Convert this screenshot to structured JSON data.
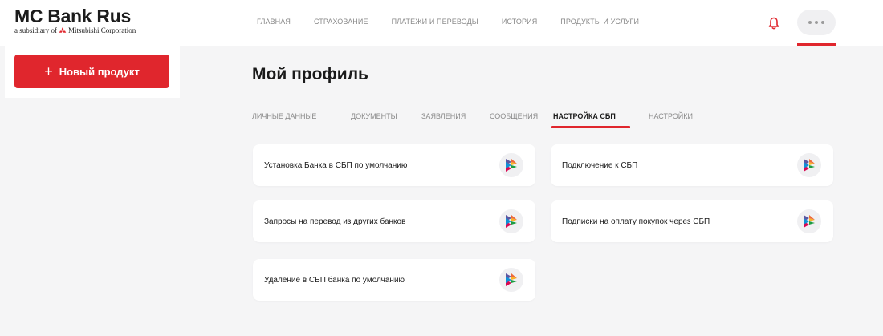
{
  "brand": {
    "title": "MC Bank Rus",
    "subtitle_prefix": "a subsidiary of",
    "subtitle_company": "Mitsubishi Corporation"
  },
  "nav": {
    "items": [
      {
        "label": "ГЛАВНАЯ"
      },
      {
        "label": "СТРАХОВАНИЕ"
      },
      {
        "label": "ПЛАТЕЖИ И ПЕРЕВОДЫ"
      },
      {
        "label": "ИСТОРИЯ"
      },
      {
        "label": "ПРОДУКТЫ И УСЛУГИ"
      }
    ],
    "bell_icon": "bell-icon",
    "more_icon": "more-dots-icon"
  },
  "sidebar": {
    "new_product_label": "Новый продукт",
    "new_product_icon": "plus-icon"
  },
  "main": {
    "title": "Мой профиль",
    "tabs": [
      {
        "label": "ЛИЧНЫЕ ДАННЫЕ",
        "active": false
      },
      {
        "label": "ДОКУМЕНТЫ",
        "active": false
      },
      {
        "label": "ЗАЯВЛЕНИЯ",
        "active": false
      },
      {
        "label": "СООБЩЕНИЯ",
        "active": false
      },
      {
        "label": "НАСТРОЙКА СБП",
        "active": true
      },
      {
        "label": "НАСТРОЙКИ",
        "active": false
      }
    ],
    "cards": [
      {
        "label": "Установка Банка в СБП по умолчанию",
        "icon": "sbp-icon"
      },
      {
        "label": "Подключение к СБП",
        "icon": "sbp-icon"
      },
      {
        "label": "Запросы на перевод из других банков",
        "icon": "sbp-icon"
      },
      {
        "label": "Подписки на оплату покупок через СБП",
        "icon": "sbp-icon"
      },
      {
        "label": "Удаление в СБП банка по умолчанию",
        "icon": "sbp-icon"
      }
    ]
  },
  "colors": {
    "accent": "#e0262d",
    "background": "#f5f5f6",
    "card": "#ffffff",
    "muted_text": "#8a8a8a"
  }
}
